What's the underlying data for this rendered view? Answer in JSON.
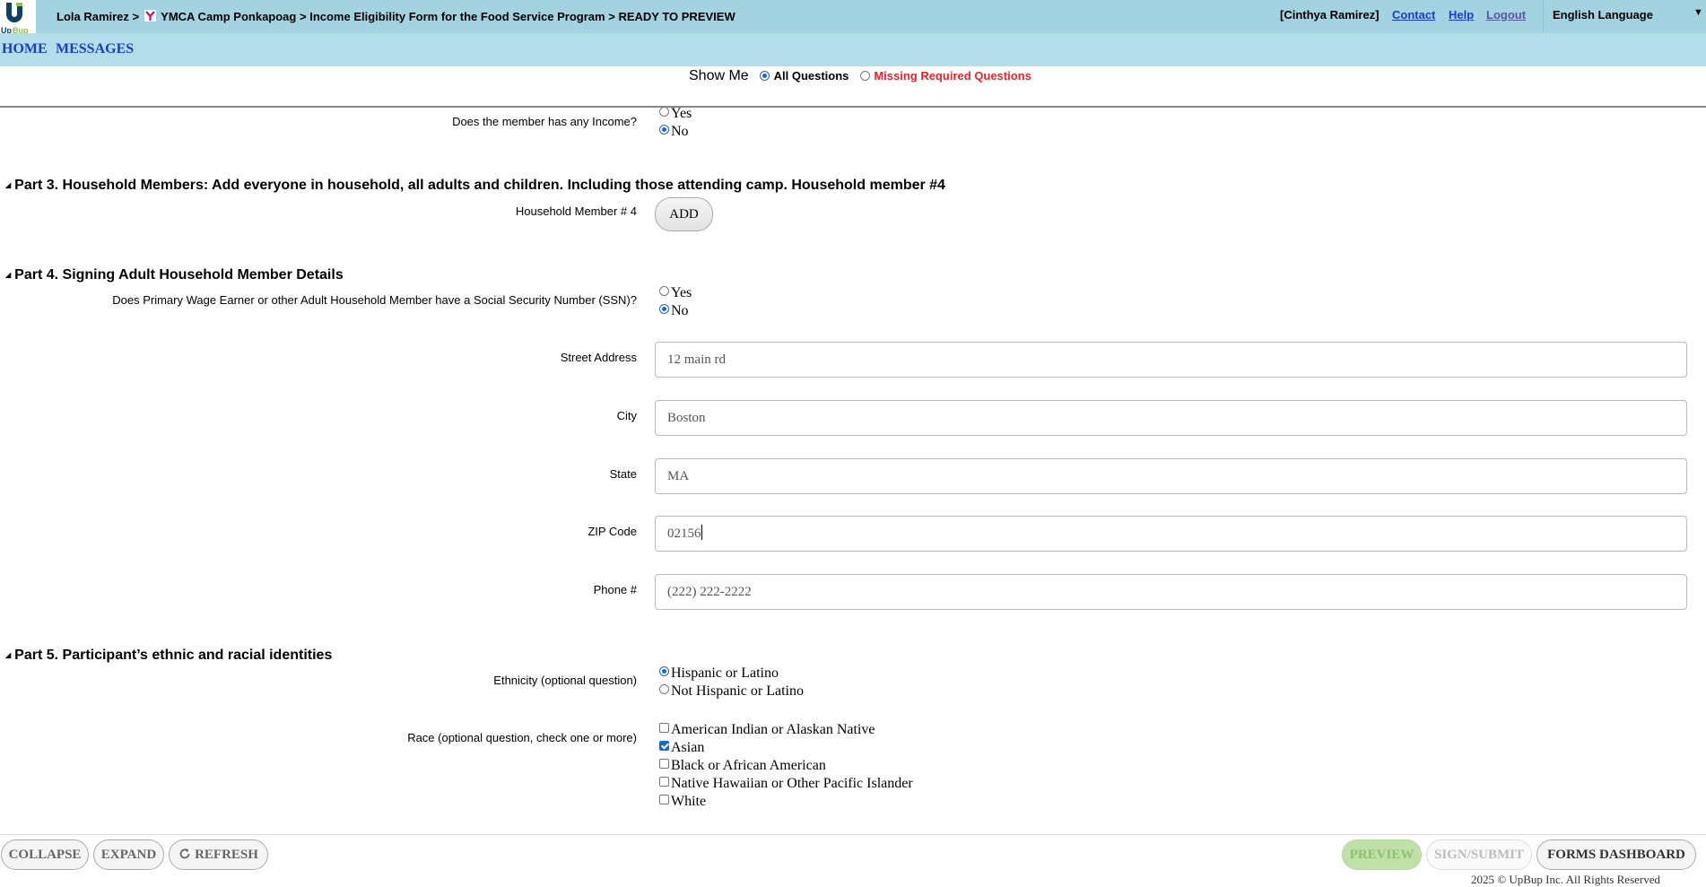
{
  "header": {
    "breadcrumb": {
      "person": "Lola Ramirez",
      "sep1": ">",
      "organization": "YMCA Camp Ponkapoag",
      "sep2": ">",
      "form": "Income Eligibility Form for the Food Service Program",
      "sep3": ">",
      "status": "READY TO PREVIEW"
    },
    "user": "[Cinthya Ramirez]",
    "links": {
      "contact": "Contact",
      "help": "Help",
      "logout": "Logout"
    },
    "language": "English Language",
    "logo_text": "UpBup"
  },
  "nav": {
    "home": "HOME",
    "messages": "MESSAGES"
  },
  "show_me": {
    "label": "Show Me",
    "options": [
      {
        "label": "All Questions",
        "selected": true
      },
      {
        "label": "Missing Required Questions",
        "selected": false
      }
    ]
  },
  "income": {
    "question": "Does the member has any Income?",
    "options": [
      {
        "label": "Yes",
        "selected": false
      },
      {
        "label": "No",
        "selected": true
      }
    ]
  },
  "part3": {
    "title": "Part 3. Household Members: Add everyone in household, all adults and children. Including those attending camp. Household member #4",
    "member_label": "Household Member # 4",
    "add_label": "ADD"
  },
  "part4": {
    "title": "Part 4. Signing Adult Household Member Details",
    "ssn_question": "Does Primary Wage Earner or other Adult Household Member have a Social Security Number (SSN)?",
    "ssn_options": [
      {
        "label": "Yes",
        "selected": false
      },
      {
        "label": "No",
        "selected": true
      }
    ],
    "fields": {
      "street": {
        "label": "Street Address",
        "value": "12 main rd"
      },
      "city": {
        "label": "City",
        "value": "Boston"
      },
      "state": {
        "label": "State",
        "value": "MA"
      },
      "zip": {
        "label": "ZIP Code",
        "value": "02156"
      },
      "phone": {
        "label": "Phone #",
        "value": "(222) 222-2222"
      }
    }
  },
  "part5": {
    "title": "Part 5. Participant’s ethnic and racial identities",
    "ethnicity_question": "Ethnicity (optional question)",
    "ethnicity_options": [
      {
        "label": "Hispanic or Latino",
        "selected": true
      },
      {
        "label": "Not Hispanic or Latino",
        "selected": false
      }
    ],
    "race_question": "Race (optional question, check one or more)",
    "race_options": [
      {
        "label": "American Indian or Alaskan Native",
        "checked": false
      },
      {
        "label": "Asian",
        "checked": true
      },
      {
        "label": "Black or African American",
        "checked": false
      },
      {
        "label": "Native Hawaiian or Other Pacific Islander",
        "checked": false
      },
      {
        "label": "White",
        "checked": false
      }
    ]
  },
  "footer": {
    "collapse": "COLLAPSE",
    "expand": "EXPAND",
    "refresh": "REFRESH",
    "preview": "PREVIEW",
    "sign_submit": "SIGN/SUBMIT",
    "forms_dashboard": "FORMS DASHBOARD",
    "copyright": "2025 © UpBup Inc. All Rights Reserved"
  },
  "colors": {
    "header_bg": "#a3d3e0",
    "nav_bg": "#b3dde9",
    "link": "#1a3ec9",
    "missing_red": "#e8232b",
    "preview_green": "#bfe0a6"
  }
}
